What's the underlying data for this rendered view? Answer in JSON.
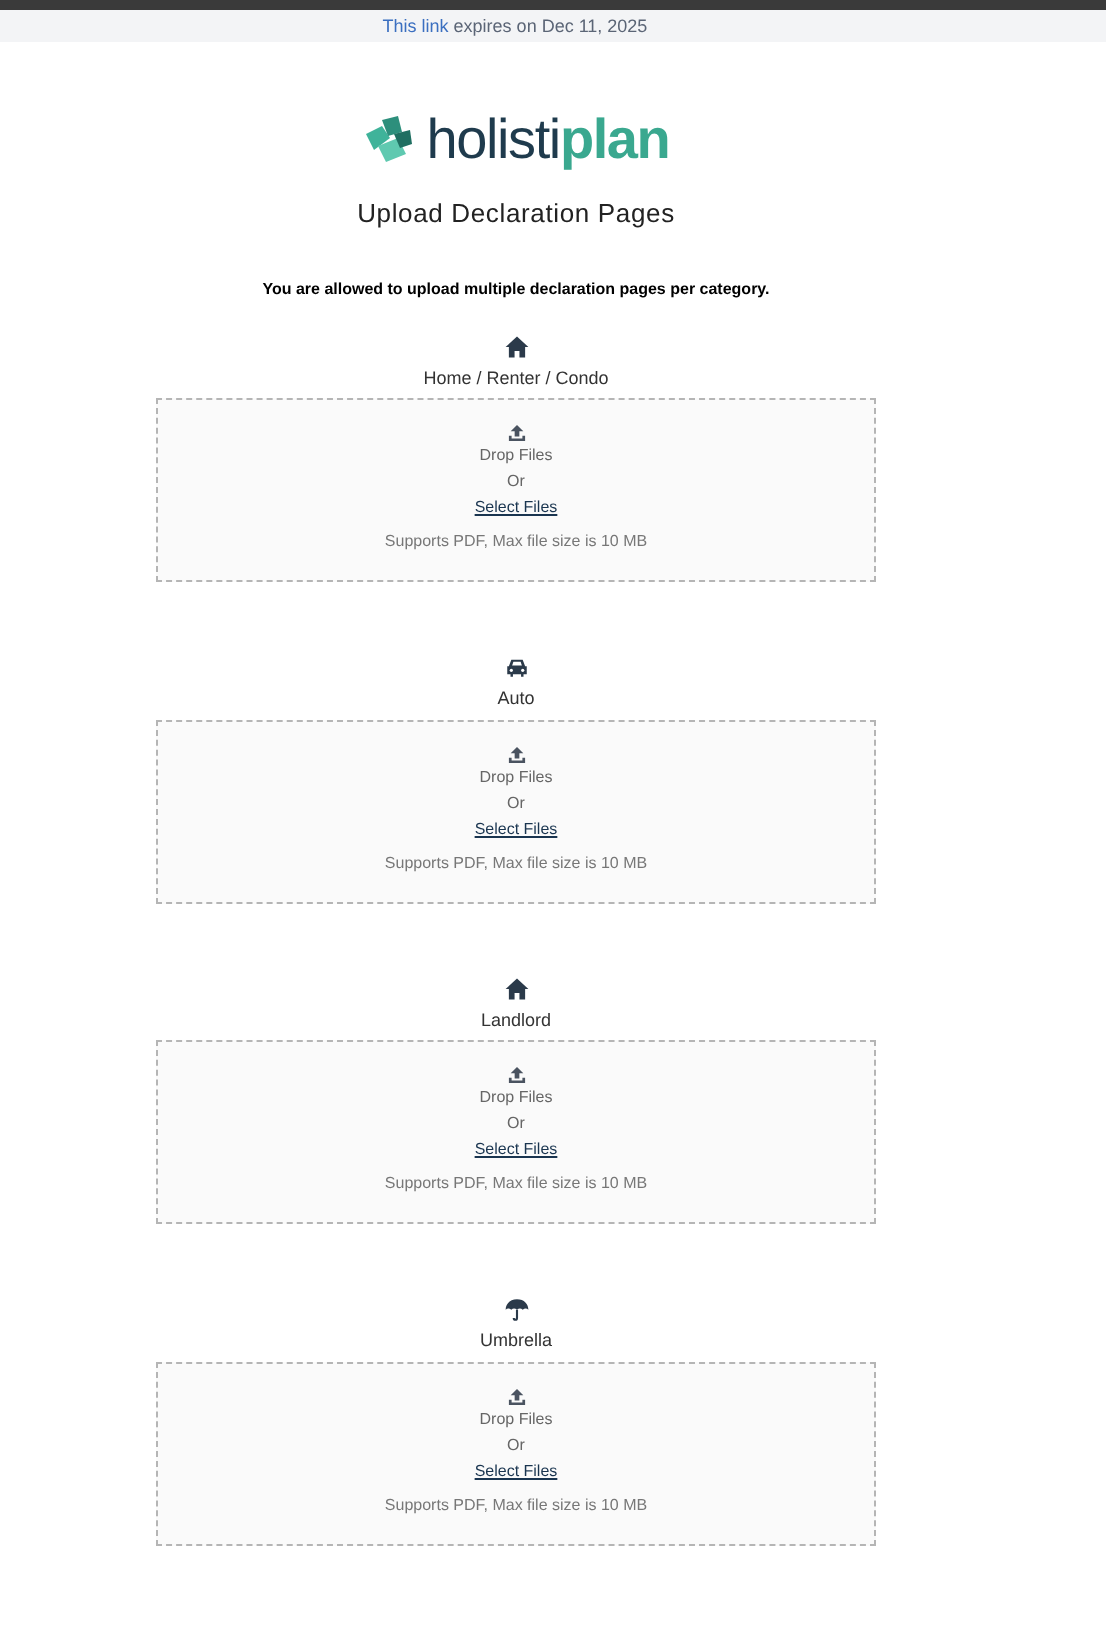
{
  "banner": {
    "prefix": "This link",
    "text": "expires on Dec 11, 2025"
  },
  "logo": {
    "dark": "holisti",
    "accent": "plan"
  },
  "title": "Upload Declaration Pages",
  "notice": "You are allowed to upload multiple declaration pages per category.",
  "categories": [
    {
      "kind": "house",
      "label": "Home / Renter / Condo",
      "drop": "Drop Files",
      "or": "Or",
      "link": "Select Files",
      "hint": "Supports PDF, Max file size is 10 MB"
    },
    {
      "kind": "car",
      "label": "Auto",
      "drop": "Drop Files",
      "or": "Or",
      "link": "Select Files",
      "hint": "Supports PDF, Max file size is 10 MB"
    },
    {
      "kind": "house",
      "label": "Landlord",
      "drop": "Drop Files",
      "or": "Or",
      "link": "Select Files",
      "hint": "Supports PDF, Max file size is 10 MB"
    },
    {
      "kind": "umbrella",
      "label": "Umbrella",
      "drop": "Drop Files",
      "or": "Or",
      "link": "Select Files",
      "hint": "Supports PDF, Max file size is 10 MB"
    }
  ]
}
